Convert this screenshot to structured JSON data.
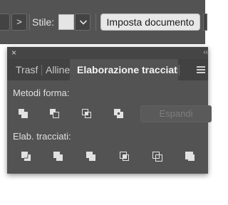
{
  "control_bar": {
    "arrow_glyph": ">",
    "style_label": "Stile:",
    "style_swatch_color": "#e5e5e5",
    "document_setup_label": "Imposta documento"
  },
  "panel": {
    "close_glyph": "×",
    "collapse_glyph": "‹‹",
    "tabs": [
      {
        "label": "Trasf",
        "active": false
      },
      {
        "label": "Alline",
        "active": false
      },
      {
        "label": "Elaborazione tracciati",
        "active": true
      }
    ],
    "shape_modes_label": "Metodi forma:",
    "shape_modes": [
      "unite-icon",
      "minus-front-icon",
      "intersect-icon",
      "exclude-icon"
    ],
    "expand_label": "Espandi",
    "pathfinders_label": "Elab. tracciati:",
    "pathfinders": [
      "divide-icon",
      "trim-icon",
      "merge-icon",
      "crop-icon",
      "outline-icon",
      "minus-back-icon"
    ]
  },
  "colors": {
    "panel_bg": "#535353",
    "tab_bar_bg": "#424242",
    "icon_light": "#e2e2e2",
    "button_light": "#e7e7e7"
  }
}
